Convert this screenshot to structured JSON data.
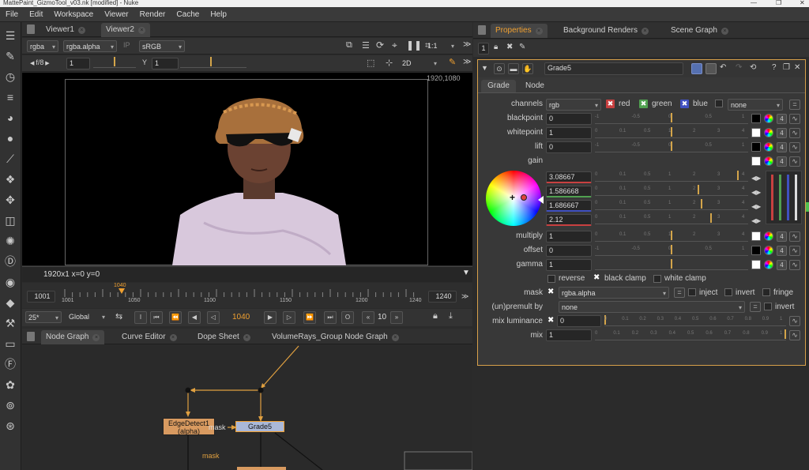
{
  "window": {
    "title": "MattePaint_GizmoTool_v03.nk [modified] - Nuke"
  },
  "menu": [
    "File",
    "Edit",
    "Workspace",
    "Viewer",
    "Render",
    "Cache",
    "Help"
  ],
  "toolbar_icons": [
    "layout-icon",
    "paint-icon",
    "time-icon",
    "channel-icon",
    "color-icon",
    "filter-icon",
    "keyer-icon",
    "merge-icon",
    "transform-icon",
    "3d-icon",
    "particles-icon",
    "deep-icon",
    "views-icon",
    "metadata-icon",
    "toolsets-icon",
    "other-icon",
    "furnace-icon",
    "cara-icon",
    "plugin-icon",
    "ocio-icon"
  ],
  "viewer_tabs": [
    {
      "label": "Viewer1"
    },
    {
      "label": "Viewer2"
    }
  ],
  "viewer_controls": {
    "channels": "rgba",
    "alpha_channel": "rgba.alpha",
    "ip": "IP",
    "colorspace": "sRGB",
    "zoom_ratio": "1:1",
    "fstop": "f/8",
    "gain_value": "1",
    "gamma_label": "Y",
    "gamma_value": "1",
    "view_mode": "2D"
  },
  "viewer": {
    "format_label": "1920,1080",
    "status": "1920x1  x=0 y=0"
  },
  "timeline": {
    "start": "1001",
    "end": "1240",
    "current": "1040",
    "ticks": [
      "1001",
      "1050",
      "1100",
      "1150",
      "1200",
      "1240"
    ]
  },
  "playback": {
    "fps": "25*",
    "scope": "Global",
    "frame": "1040",
    "step": "10"
  },
  "nodegraph_tabs": [
    {
      "label": "Node Graph"
    },
    {
      "label": "Curve Editor"
    },
    {
      "label": "Dope Sheet"
    },
    {
      "label": "VolumeRays_Group Node Graph"
    }
  ],
  "nodes": {
    "edge": {
      "name": "EdgeDetect1",
      "sub": "(alpha)"
    },
    "grade": {
      "name": "Grade5"
    },
    "mask_label_1": "mask",
    "mask_label_2": "mask"
  },
  "properties_tabs": [
    {
      "label": "Properties"
    },
    {
      "label": "Background Renders"
    },
    {
      "label": "Scene Graph"
    }
  ],
  "properties": {
    "count": "1",
    "node_name": "Grade5",
    "sub_tabs": [
      "Grade",
      "Node"
    ],
    "channels": {
      "label": "channels",
      "value": "rgb",
      "red": "red",
      "green": "green",
      "blue": "blue",
      "extra": "none"
    },
    "blackpoint": {
      "label": "blackpoint",
      "value": "0"
    },
    "whitepoint": {
      "label": "whitepoint",
      "value": "1"
    },
    "lift": {
      "label": "lift",
      "value": "0"
    },
    "gain": {
      "label": "gain",
      "r": "3.08667",
      "g": "1.586668",
      "b": "1.686667",
      "a": "2.12"
    },
    "multiply": {
      "label": "multiply",
      "value": "1"
    },
    "offset": {
      "label": "offset",
      "value": "0"
    },
    "gamma": {
      "label": "gamma",
      "value": "1"
    },
    "reverse": "reverse",
    "black_clamp": "black clamp",
    "white_clamp": "white clamp",
    "mask": {
      "label": "mask",
      "value": "rgba.alpha",
      "inject": "inject",
      "invert": "invert",
      "fringe": "fringe"
    },
    "unpremult": {
      "label": "(un)premult by",
      "value": "none",
      "invert": "invert"
    },
    "mix_luminance": {
      "label": "mix luminance",
      "value": "0"
    },
    "mix": {
      "label": "mix",
      "value": "1"
    },
    "slider_ticks_a": [
      "-1",
      "-0.5",
      "0",
      "0.5",
      "1"
    ],
    "slider_ticks_b": [
      "0",
      "0.1",
      "0.5",
      "1",
      "2",
      "3",
      "4"
    ],
    "slider_ticks_c": [
      "0",
      "0.1",
      "0.2",
      "0.3",
      "0.4",
      "0.5",
      "0.6",
      "0.7",
      "0.8",
      "0.9",
      "1"
    ],
    "channel_count": "4"
  },
  "colors": {
    "accent": "#f0a030",
    "panel_border": "#d7a04a",
    "node_grade": "#aab8d8",
    "node_edge": "#d89a60"
  }
}
